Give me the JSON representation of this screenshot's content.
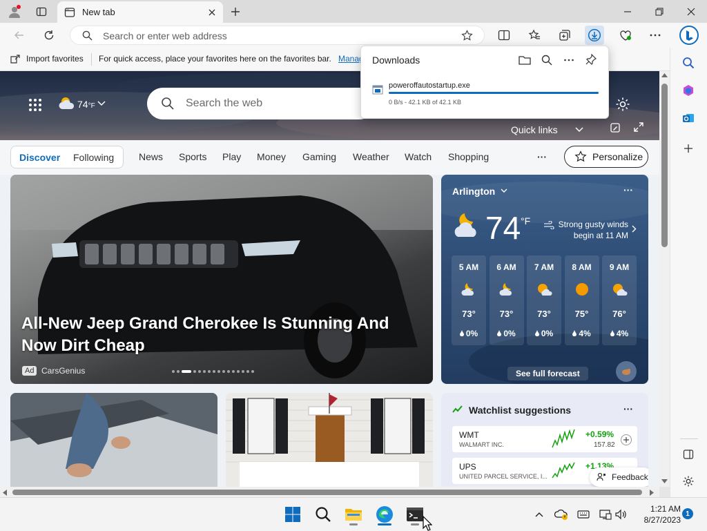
{
  "browser": {
    "tab_title": "New tab",
    "address_placeholder": "Search or enter web address"
  },
  "favorites_bar": {
    "import_label": "Import favorites",
    "hint": "For quick access, place your favorites here on the favorites bar.",
    "manage_link": "Manag"
  },
  "downloads": {
    "title": "Downloads",
    "file_name": "poweroffautostartup.exe",
    "status": "0 B/s - 42.1 KB of 42.1 KB",
    "progress": 1.0
  },
  "hero": {
    "temp": "74",
    "unit": "°F",
    "search_placeholder": "Search the web",
    "quick_links": "Quick links"
  },
  "nav": {
    "discover": "Discover",
    "following": "Following",
    "items": [
      "News",
      "Sports",
      "Play",
      "Money",
      "Gaming",
      "Weather",
      "Watch",
      "Shopping"
    ],
    "more": "···",
    "personalize": "Personalize"
  },
  "main_story": {
    "headline": "All-New Jeep Grand Cherokee Is Stunning And Now Dirt Cheap",
    "ad_label": "Ad",
    "source": "CarsGenius",
    "slide_count": 16,
    "active_slide": 2
  },
  "weather": {
    "location": "Arlington",
    "temp": "74",
    "unit": "°F",
    "alert": "Strong gusty winds begin at 11 AM",
    "hourly": [
      {
        "hour": "5 AM",
        "temp": "73°",
        "precip": "0%",
        "icon": "moon-cloud-icon"
      },
      {
        "hour": "6 AM",
        "temp": "73°",
        "precip": "0%",
        "icon": "moon-cloud-icon"
      },
      {
        "hour": "7 AM",
        "temp": "73°",
        "precip": "0%",
        "icon": "sun-cloud-icon"
      },
      {
        "hour": "8 AM",
        "temp": "75°",
        "precip": "4%",
        "icon": "sun-icon"
      },
      {
        "hour": "9 AM",
        "temp": "76°",
        "precip": "4%",
        "icon": "sun-cloud-icon"
      }
    ],
    "forecast_link": "See full forecast"
  },
  "watchlist": {
    "title": "Watchlist suggestions",
    "stocks": [
      {
        "symbol": "WMT",
        "name": "WALMART INC.",
        "change": "+0.59%",
        "price": "157.82"
      },
      {
        "symbol": "UPS",
        "name": "UNITED PARCEL SERVICE, I...",
        "change": "+1.13%",
        "price": ""
      }
    ],
    "feedback": "Feedback"
  },
  "taskbar": {
    "time": "1:21 AM",
    "date": "8/27/2023",
    "notifications": "1"
  },
  "colors": {
    "accent": "#0f6cbd",
    "positive": "#13a10e",
    "weather_bg": "#2c4a72"
  }
}
